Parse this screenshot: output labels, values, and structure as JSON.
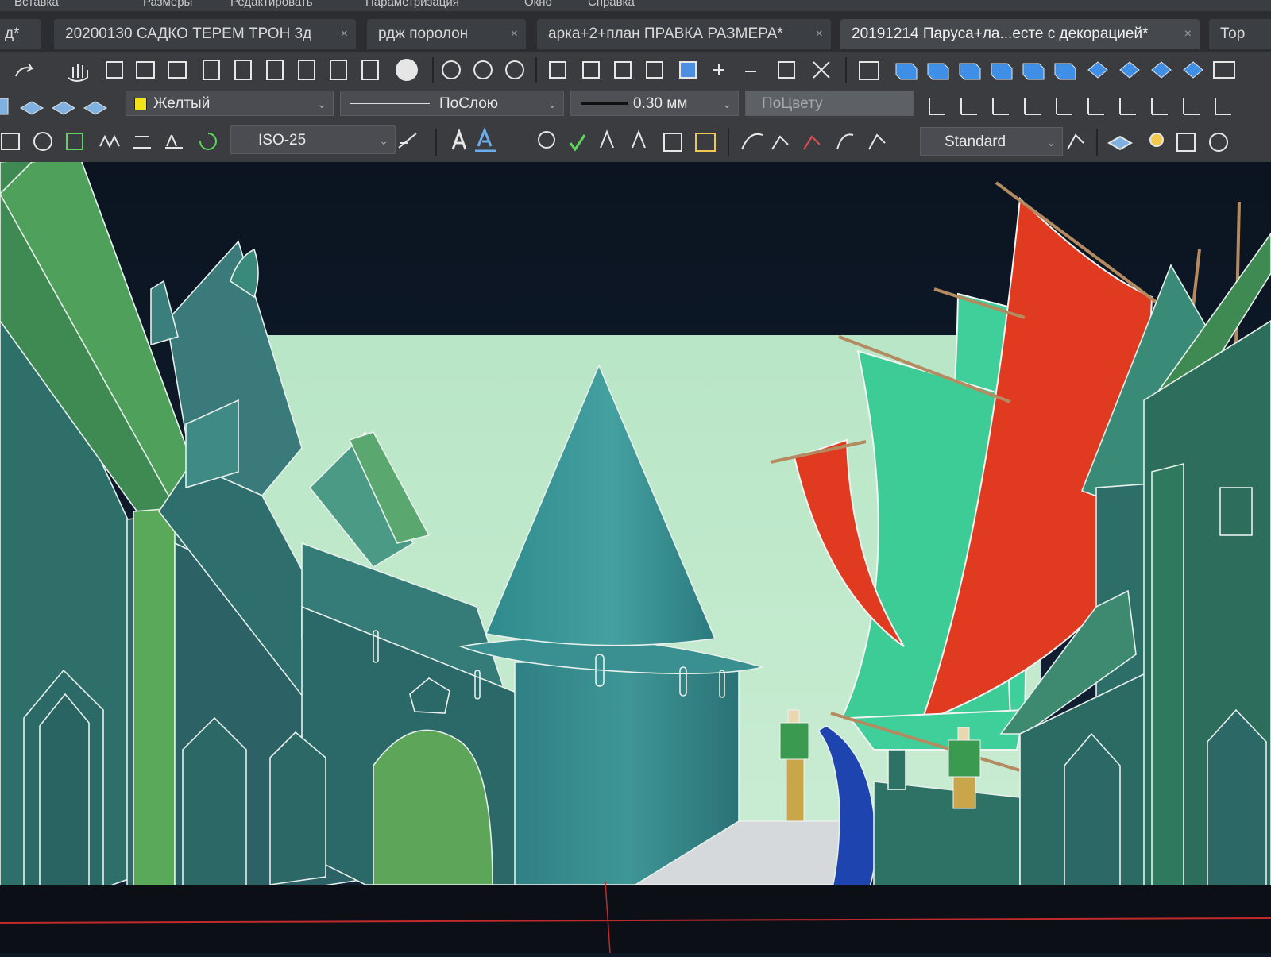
{
  "menu": [
    "Вставка",
    "Размеры",
    "Редактировать",
    "Параметризация",
    "Окно",
    "Справка"
  ],
  "tabs": [
    {
      "label": "д*",
      "active": false
    },
    {
      "label": "20200130 САДКО ТЕРЕМ ТРОН 3д",
      "active": false
    },
    {
      "label": "рдж поролон",
      "active": false
    },
    {
      "label": "арка+2+план ПРАВКА РАЗМЕРА*",
      "active": false
    },
    {
      "label": "20191214 Паруса+ла...есте с декорацией*",
      "active": true
    },
    {
      "label": "Тор",
      "active": false
    }
  ],
  "tab_close": "×",
  "properties": {
    "color": "Желтый",
    "color_swatch": "#f2e21a",
    "linetype": "ПоСлою",
    "lineweight": "0.30 мм",
    "plotstyle": "ПоЦвету"
  },
  "annotation": {
    "dimstyle": "ISO-25",
    "textstyle": "Standard"
  },
  "scene": {
    "sail_red": "#e03a20",
    "sail_green": "#3fcf9a",
    "sky": "#0e1828",
    "backdrop": "#b4e4c4",
    "tower": "#3a8c8e",
    "boat_blue": "#1e44b0"
  }
}
